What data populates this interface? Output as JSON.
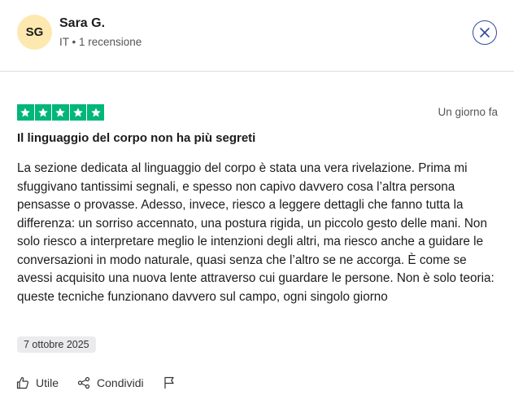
{
  "reviewer": {
    "initials": "SG",
    "name": "Sara G.",
    "meta": "IT • 1 recensione"
  },
  "review": {
    "rating": 5,
    "relative_date": "Un giorno fa",
    "title": "Il linguaggio del corpo non ha più segreti",
    "body": "La sezione dedicata al linguaggio del corpo è stata una vera rivelazione. Prima mi sfuggivano tantissimi segnali, e spesso non capivo davvero cosa l’altra persona pensasse o provasse. Adesso, invece, riesco a leggere dettagli che fanno tutta la differenza: un sorriso accennato, una postura rigida, un piccolo gesto delle mani. Non solo riesco a interpretare meglio le intenzioni degli altri, ma riesco anche a guidare le conversazioni in modo naturale, quasi senza che l’altro se ne accorga. È come se avessi acquisito una nuova lente attraverso cui guardare le persone. Non è solo teoria: queste tecniche funzionano davvero sul campo, ogni singolo giorno",
    "experience_date": "7 ottobre 2025"
  },
  "actions": {
    "useful_label": "Utile",
    "share_label": "Condividi"
  },
  "colors": {
    "star_green": "#00b67a",
    "avatar_bg": "#fde9b0",
    "close_blue": "#2f4b9a"
  },
  "icons": [
    "close-icon",
    "star-icon",
    "thumbs-up-icon",
    "share-icon",
    "flag-icon"
  ]
}
